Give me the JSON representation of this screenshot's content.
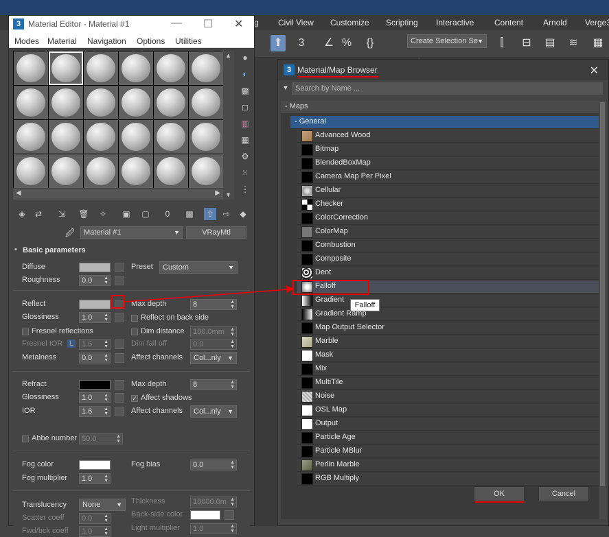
{
  "app": {
    "menu": [
      "Civil View",
      "Customize",
      "Scripting",
      "Interactive",
      "Content",
      "Arnold",
      "Verge3"
    ],
    "selection_set": "Create Selection Se"
  },
  "material_editor": {
    "title": "Material Editor - Material #1",
    "menu": [
      "Modes",
      "Material",
      "Navigation",
      "Options",
      "Utilities"
    ],
    "material_name": "Material #1",
    "material_type": "VRayMtl",
    "basic_parameters": "Basic parameters",
    "diffuse": "Diffuse",
    "preset_label": "Preset",
    "preset_value": "Custom",
    "roughness": "Roughness",
    "roughness_value": "0.0",
    "reflect": "Reflect",
    "max_depth": "Max depth",
    "max_depth_value": "8",
    "glossiness": "Glossiness",
    "glossiness_value": "1.0",
    "reflect_back": "Reflect on back side",
    "fresnel": "Fresnel reflections",
    "dim_distance": "Dim distance",
    "dim_distance_value": "100.0mm",
    "fresnel_ior": "Fresnel IOR",
    "fresnel_ior_lock": "L",
    "fresnel_ior_value": "1.6",
    "dim_falloff": "Dim fall off",
    "dim_falloff_value": "0.0",
    "metalness": "Metalness",
    "metalness_value": "0.0",
    "affect_channels": "Affect channels",
    "affect_channels_value": "Col...nly",
    "refract": "Refract",
    "refract_max_depth_value": "8",
    "refract_glossiness_value": "1.0",
    "affect_shadows": "Affect shadows",
    "ior": "IOR",
    "ior_value": "1.6",
    "abbe": "Abbe number",
    "abbe_value": "50.0",
    "fog_color": "Fog color",
    "fog_bias": "Fog bias",
    "fog_bias_value": "0.0",
    "fog_multiplier": "Fog multiplier",
    "fog_multiplier_value": "1.0",
    "translucency": "Translucency",
    "translucency_value": "None",
    "thickness": "Thickness",
    "thickness_value": "10000.0m",
    "scatter_coeff": "Scatter coeff",
    "scatter_coeff_value": "0.0",
    "back_side_color": "Back-side color",
    "fwd_bck_coeff": "Fwd/bck coeff",
    "fwd_bck_coeff_value": "1.0",
    "light_multiplier": "Light multiplier",
    "light_multiplier_value": "1.0"
  },
  "browser": {
    "title": "Material/Map Browser",
    "search_placeholder": "Search by Name ...",
    "maps_group": "- Maps",
    "general_group": "- General",
    "items": [
      "Advanced Wood",
      "Bitmap",
      "BlendedBoxMap",
      "Camera Map Per Pixel",
      "Cellular",
      "Checker",
      "ColorCorrection",
      "ColorMap",
      "Combustion",
      "Composite",
      "Dent",
      "Falloff",
      "Gradient",
      "Gradient Ramp",
      "Map Output Selector",
      "Marble",
      "Mask",
      "Mix",
      "MultiTile",
      "Noise",
      "OSL Map",
      "Output",
      "Particle Age",
      "Particle MBlur",
      "Perlin Marble",
      "RGB Multiply"
    ],
    "tooltip": "Falloff",
    "ok": "OK",
    "cancel": "Cancel"
  }
}
